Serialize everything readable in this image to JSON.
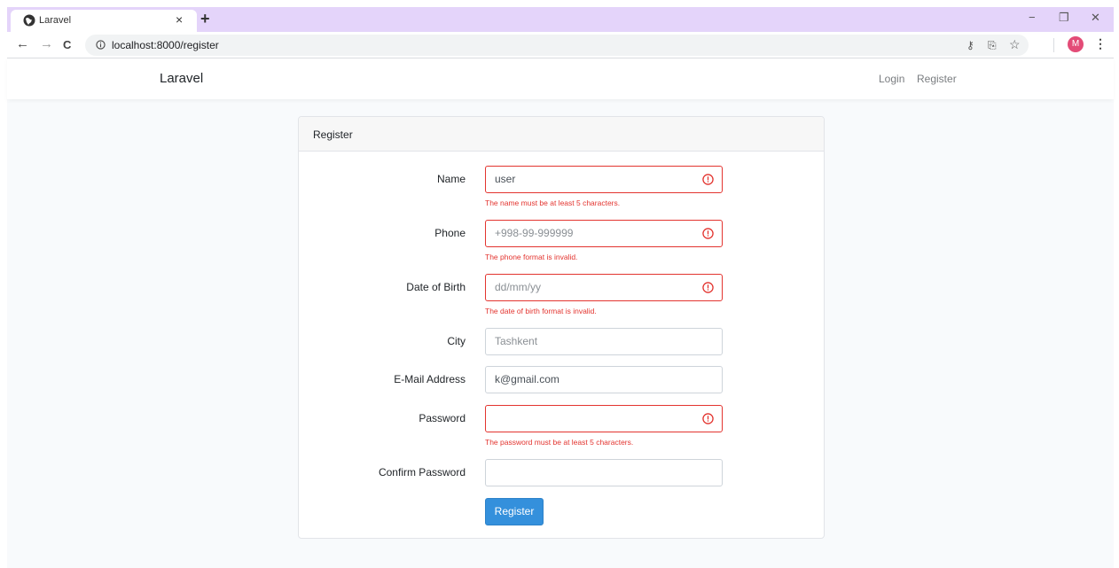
{
  "browser": {
    "tab_title": "Laravel",
    "tab_close": "×",
    "new_tab": "+",
    "url": "localhost:8000/register",
    "avatar_letter": "M",
    "window_controls": {
      "minimize": "−",
      "restore": "❐",
      "close": "✕"
    },
    "nav": {
      "back": "←",
      "forward": "→",
      "reload": "C"
    },
    "omnibox_icons": {
      "key": "⚷",
      "translate": "⎘",
      "bookmark": "☆"
    },
    "menu": "⋮"
  },
  "navbar": {
    "brand": "Laravel",
    "links": {
      "login": "Login",
      "register": "Register"
    }
  },
  "card": {
    "header": "Register",
    "fields": {
      "name": {
        "label": "Name",
        "value": "user",
        "error": "The name must be at least 5 characters."
      },
      "phone": {
        "label": "Phone",
        "placeholder": "+998-99-999999",
        "error": "The phone format is invalid."
      },
      "dob": {
        "label": "Date of Birth",
        "placeholder": "dd/mm/yy",
        "error": "The date of birth format is invalid."
      },
      "city": {
        "label": "City",
        "placeholder": "Tashkent"
      },
      "email": {
        "label": "E-Mail Address",
        "value": "k@gmail.com"
      },
      "password": {
        "label": "Password",
        "value": "",
        "error": "The password must be at least 5 characters."
      },
      "confirm": {
        "label": "Confirm Password",
        "value": ""
      }
    },
    "submit": "Register"
  },
  "colors": {
    "error": "#e3342f",
    "primary": "#3490dc",
    "tab_strip": "#e4d4fa"
  }
}
